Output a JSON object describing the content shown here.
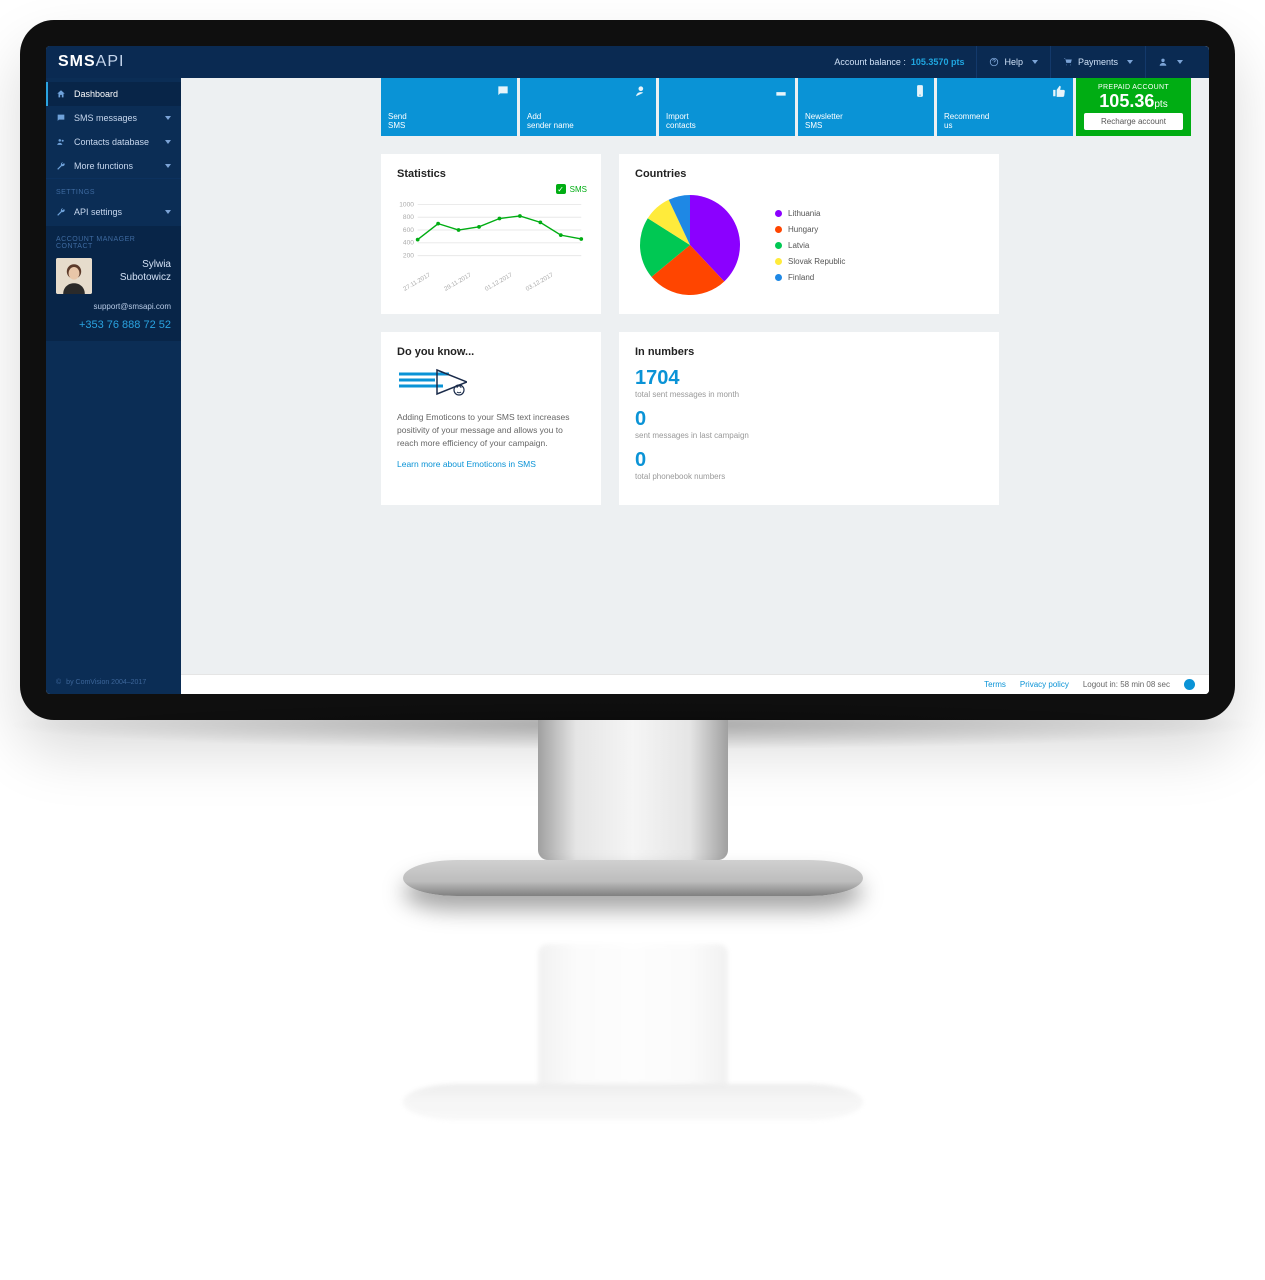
{
  "brand": {
    "main": "SMS",
    "sub": "API"
  },
  "header": {
    "balance_label": "Account balance :",
    "balance_value": "105.3570 pts",
    "help": "Help",
    "payments": "Payments"
  },
  "sidebar": {
    "items": [
      {
        "label": "Dashboard"
      },
      {
        "label": "SMS messages"
      },
      {
        "label": "Contacts database"
      },
      {
        "label": "More functions"
      }
    ],
    "settings_heading": "SETTINGS",
    "api_settings": "API settings",
    "acct_mgr_heading": "ACCOUNT MANAGER CONTACT",
    "manager": {
      "first": "Sylwia",
      "last": "Subotowicz",
      "email": "support@smsapi.com",
      "phone": "+353 76 888 72 52"
    },
    "copyright": "by ComVision 2004–2017"
  },
  "tiles": [
    {
      "label": "Send\nSMS"
    },
    {
      "label": "Add\nsender name"
    },
    {
      "label": "Import\ncontacts"
    },
    {
      "label": "Newsletter\nSMS"
    },
    {
      "label": "Recommend\nus"
    }
  ],
  "prepaid": {
    "label": "PREPAID ACCOUNT",
    "value": "105.36",
    "units": "pts",
    "button": "Recharge account"
  },
  "statistics": {
    "title": "Statistics",
    "legend": "SMS"
  },
  "countries": {
    "title": "Countries"
  },
  "doyouknow": {
    "title": "Do you know...",
    "text": "Adding Emoticons to your SMS text increases positivity of your message and allows you to reach more efficiency of your campaign.",
    "link": "Learn more about Emoticons in SMS"
  },
  "numbers": {
    "title": "In numbers",
    "items": [
      {
        "value": "1704",
        "label": "total sent messages in month"
      },
      {
        "value": "0",
        "label": "sent messages in last campaign"
      },
      {
        "value": "0",
        "label": "total phonebook numbers"
      }
    ]
  },
  "footer": {
    "terms": "Terms",
    "privacy": "Privacy policy",
    "logout": "Logout in: 58 min 08 sec"
  },
  "chart_data": [
    {
      "type": "line",
      "title": "Statistics",
      "series": [
        {
          "name": "SMS",
          "values": [
            450,
            700,
            600,
            650,
            780,
            820,
            720,
            520,
            460
          ]
        }
      ],
      "categories": [
        "27.11.2017",
        "",
        "29.11.2017",
        "",
        "01.12.2017",
        "",
        "03.12.2017",
        "",
        ""
      ],
      "ylabel": "",
      "xlabel": "",
      "ylim": [
        0,
        1000
      ],
      "yticks": [
        200,
        400,
        600,
        800,
        1000
      ]
    },
    {
      "type": "pie",
      "title": "Countries",
      "series": [
        {
          "name": "Lithuania",
          "value": 38,
          "color": "#8b00ff"
        },
        {
          "name": "Hungary",
          "value": 26,
          "color": "#ff4500"
        },
        {
          "name": "Latvia",
          "value": 20,
          "color": "#00c853"
        },
        {
          "name": "Slovak Republic",
          "value": 9,
          "color": "#ffeb3b"
        },
        {
          "name": "Finland",
          "value": 7,
          "color": "#1e88e5"
        }
      ]
    }
  ]
}
